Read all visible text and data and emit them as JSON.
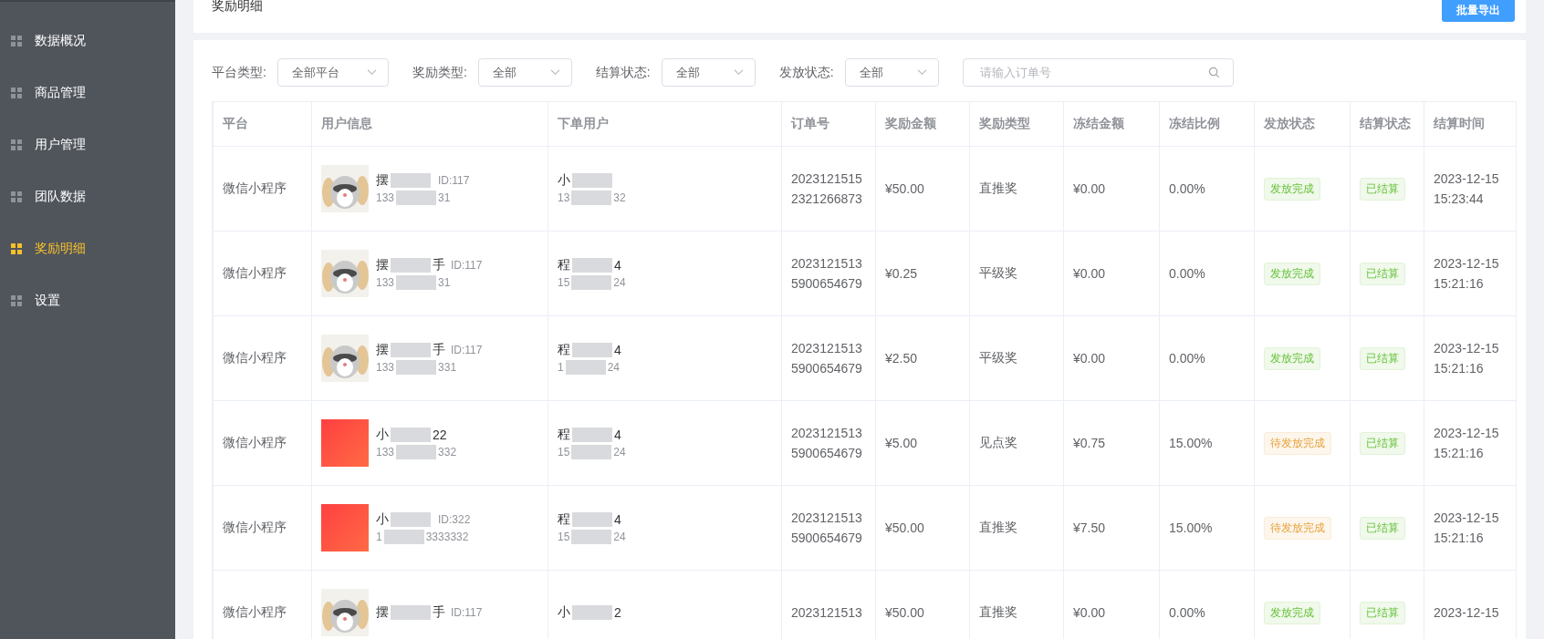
{
  "sidebar": {
    "items": [
      {
        "label": "数据概况",
        "selected": false
      },
      {
        "label": "商品管理",
        "selected": false
      },
      {
        "label": "用户管理",
        "selected": false
      },
      {
        "label": "团队数据",
        "selected": false
      },
      {
        "label": "奖励明细",
        "selected": true
      },
      {
        "label": "设置",
        "selected": false
      }
    ]
  },
  "header": {
    "title": "奖励明细",
    "export_button": "批量导出"
  },
  "filters": [
    {
      "label": "平台类型:",
      "value": "全部平台"
    },
    {
      "label": "奖励类型:",
      "value": "全部"
    },
    {
      "label": "结算状态:",
      "value": "全部"
    },
    {
      "label": "发放状态:",
      "value": "全部"
    }
  ],
  "search": {
    "placeholder": "请输入订单号"
  },
  "table": {
    "columns": [
      "平台",
      "用户信息",
      "下单用户",
      "订单号",
      "奖励金额",
      "奖励类型",
      "冻结金额",
      "冻结比例",
      "发放状态",
      "结算状态",
      "结算时间"
    ],
    "rows": [
      {
        "platform": "微信小程序",
        "user": {
          "avatar": {
            "kind": "raccoon"
          },
          "name_start": "摆",
          "id": "ID:117",
          "phone_start": "133",
          "phone_end": "31"
        },
        "buyer": {
          "name_start": "小",
          "phone_start": "13",
          "phone_end": "32"
        },
        "order_no": "20231215152321266873",
        "amount": "¥50.00",
        "reward_type": "直推奖",
        "frozen_amount": "¥0.00",
        "frozen_ratio": "0.00%",
        "issue_status": {
          "text": "发放完成",
          "kind": "success"
        },
        "settle_status": {
          "text": "已结算",
          "kind": "success"
        },
        "settle_time": "2023-12-15 15:23:44"
      },
      {
        "platform": "微信小程序",
        "user": {
          "avatar": {
            "kind": "raccoon"
          },
          "name_start": "摆",
          "name_end": "手",
          "id": "ID:117",
          "phone_start": "133",
          "phone_end": "31"
        },
        "buyer": {
          "name_start": "程",
          "name_end": "4",
          "phone_start": "15",
          "phone_end": "24"
        },
        "order_no": "20231215135900654679",
        "amount": "¥0.25",
        "reward_type": "平级奖",
        "frozen_amount": "¥0.00",
        "frozen_ratio": "0.00%",
        "issue_status": {
          "text": "发放完成",
          "kind": "success"
        },
        "settle_status": {
          "text": "已结算",
          "kind": "success"
        },
        "settle_time": "2023-12-15 15:21:16"
      },
      {
        "platform": "微信小程序",
        "user": {
          "avatar": {
            "kind": "raccoon"
          },
          "name_start": "摆",
          "name_end": "手",
          "id": "ID:117",
          "phone_start": "133",
          "phone_end": "331"
        },
        "buyer": {
          "name_start": "程",
          "name_end": "4",
          "phone_start": "1",
          "phone_end": "24"
        },
        "order_no": "20231215135900654679",
        "amount": "¥2.50",
        "reward_type": "平级奖",
        "frozen_amount": "¥0.00",
        "frozen_ratio": "0.00%",
        "issue_status": {
          "text": "发放完成",
          "kind": "success"
        },
        "settle_status": {
          "text": "已结算",
          "kind": "success"
        },
        "settle_time": "2023-12-15 15:21:16"
      },
      {
        "platform": "微信小程序",
        "user": {
          "avatar": {
            "kind": "red"
          },
          "name_start": "小",
          "name_end": "22",
          "phone_start": "133",
          "phone_end": "332"
        },
        "buyer": {
          "name_start": "程",
          "name_end": "4",
          "phone_start": "15",
          "phone_end": "24"
        },
        "order_no": "20231215135900654679",
        "amount": "¥5.00",
        "reward_type": "见点奖",
        "frozen_amount": "¥0.75",
        "frozen_ratio": "15.00%",
        "issue_status": {
          "text": "待发放完成",
          "kind": "warning"
        },
        "settle_status": {
          "text": "已结算",
          "kind": "success"
        },
        "settle_time": "2023-12-15 15:21:16"
      },
      {
        "platform": "微信小程序",
        "user": {
          "avatar": {
            "kind": "red"
          },
          "name_start": "小",
          "id": "ID:322",
          "phone_start": "1",
          "phone_end": "3333332"
        },
        "buyer": {
          "name_start": "程",
          "name_end": "4",
          "phone_start": "15",
          "phone_end": "24"
        },
        "order_no": "20231215135900654679",
        "amount": "¥50.00",
        "reward_type": "直推奖",
        "frozen_amount": "¥7.50",
        "frozen_ratio": "15.00%",
        "issue_status": {
          "text": "待发放完成",
          "kind": "warning"
        },
        "settle_status": {
          "text": "已结算",
          "kind": "success"
        },
        "settle_time": "2023-12-15 15:21:16"
      },
      {
        "platform": "微信小程序",
        "user": {
          "avatar": {
            "kind": "raccoon"
          },
          "name_start": "摆",
          "name_end": "手",
          "id": "ID:117"
        },
        "buyer": {
          "name_start": "小",
          "name_end": "2"
        },
        "order_no": "2023121513",
        "amount": "¥50.00",
        "reward_type": "直推奖",
        "frozen_amount": "¥0.00",
        "frozen_ratio": "0.00%",
        "issue_status": {
          "text": "发放完成",
          "kind": "success"
        },
        "settle_status": {
          "text": "已结算",
          "kind": "success"
        },
        "settle_time": "2023-12-15"
      }
    ]
  }
}
